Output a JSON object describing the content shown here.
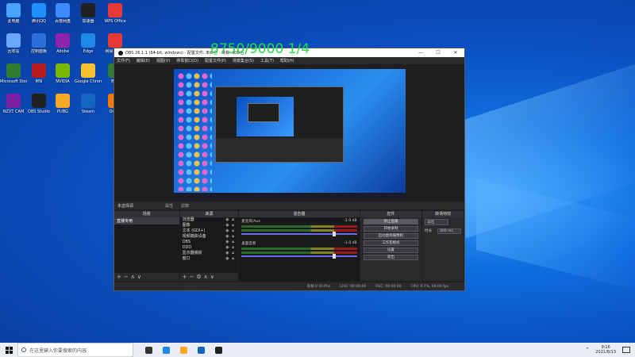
{
  "overlay_counter": "8750/9000 1/4",
  "desktop_icons": [
    {
      "label": "此电脑",
      "color": "#4aa3ff"
    },
    {
      "label": "腾讯QQ",
      "color": "#1e90ff"
    },
    {
      "label": "百度网盘",
      "color": "#3d8bff"
    },
    {
      "label": "加速器",
      "color": "#222"
    },
    {
      "label": "WPS Office",
      "color": "#e53935"
    },
    {
      "label": "回收站",
      "color": "#6aa8ff"
    },
    {
      "label": "控制面板",
      "color": "#2d6fd8"
    },
    {
      "label": "Adobe",
      "color": "#8e24aa"
    },
    {
      "label": "Edge",
      "color": "#1e88e5"
    },
    {
      "label": "网易云音乐",
      "color": "#e53935"
    },
    {
      "label": "Microsoft Store",
      "color": "#2e7d32"
    },
    {
      "label": "MSI",
      "color": "#b71c1c"
    },
    {
      "label": "NVIDIA",
      "color": "#76b900"
    },
    {
      "label": "Google Chrome",
      "color": "#fbc02d"
    },
    {
      "label": "微信",
      "color": "#2e7d32"
    },
    {
      "label": "NZXT CAM",
      "color": "#7b1fa2"
    },
    {
      "label": "OBS Studio",
      "color": "#222"
    },
    {
      "label": "PUBG",
      "color": "#f9a825"
    },
    {
      "label": "Steam",
      "color": "#1565c0"
    },
    {
      "label": "Origin",
      "color": "#f57c00"
    }
  ],
  "obs": {
    "title": "OBS 26.1.1 (64-bit, windows) - 配置文件: 未命名 - 场景: 未命名",
    "window_buttons": [
      "—",
      "☐",
      "✕"
    ],
    "menu": [
      "文件(F)",
      "编辑(E)",
      "视图(V)",
      "停靠窗口(D)",
      "配置文件(P)",
      "场景集合(S)",
      "工具(T)",
      "帮助(H)"
    ],
    "scene_bar": {
      "no_source": "未选择源",
      "properties": "属性",
      "filters": "滤镜"
    },
    "docks": {
      "scenes": "场景",
      "sources": "来源",
      "mixer": "混音器",
      "controls": "控件",
      "transitions": "转场特效"
    },
    "scenes": [
      "直播专用"
    ],
    "sources": [
      "浏览器",
      "图像",
      "文本 (GDI+)",
      "视频捕获设备",
      "OBS",
      "DDD",
      "显示器捕获",
      "窗口"
    ],
    "mixer": [
      {
        "name": "麦克风/Aux",
        "db": "-1.0 dB"
      },
      {
        "name": "桌面音频",
        "db": "-1.0 dB"
      }
    ],
    "controls": [
      "停止直播",
      "开始录制",
      "启动虚拟摄像机",
      "工作室模式",
      "设置",
      "退出"
    ],
    "transition": {
      "type": "淡出",
      "duration_label": "时长",
      "duration_value": "300 ms"
    },
    "statusbar": {
      "drop": "丢帧 0 (0.0%)",
      "live": "LIVE: 00:00:00",
      "rec": "REC: 00:00:00",
      "cpu": "CPU: 0.7%, 60.00 fps"
    }
  },
  "taskbar": {
    "search_placeholder": "在这里输入你要搜索的内容",
    "time": "9:16",
    "date": "2021/8/13",
    "app_icons": [
      "#333",
      "#1e88e5",
      "#f9a825",
      "#1565c0",
      "#222"
    ]
  }
}
